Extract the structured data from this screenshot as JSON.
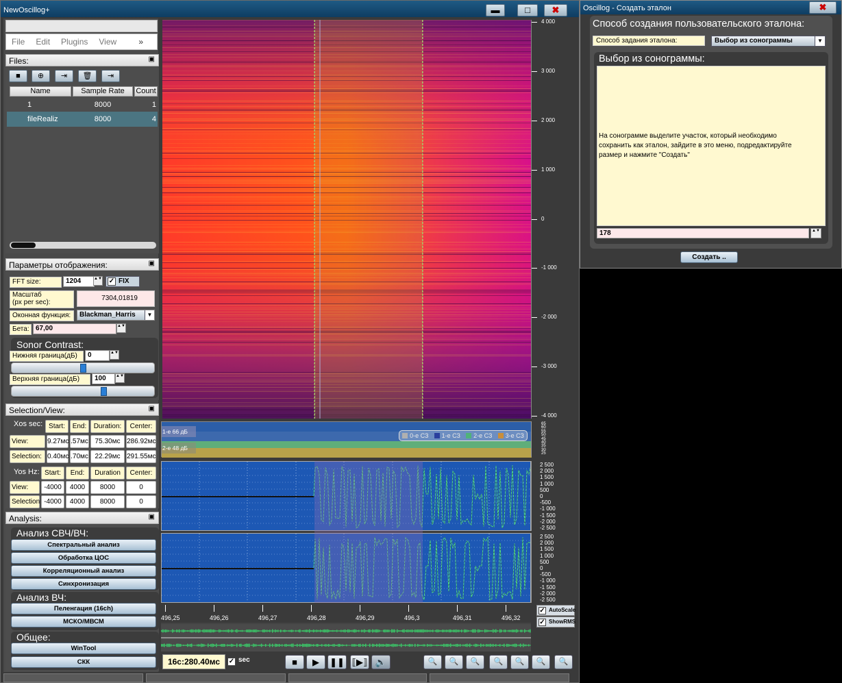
{
  "main_window": {
    "title": "NewOscillog+",
    "min_label": "▬",
    "max_label": "□",
    "close_label": "✖"
  },
  "menu": [
    "File",
    "Edit",
    "Plugins",
    "View"
  ],
  "menu_more": "»",
  "files": {
    "header": "Files:",
    "columns": [
      "Name",
      "Sample Rate",
      "Count"
    ],
    "rows": [
      {
        "name": "1",
        "rate": "8000",
        "count": "1"
      },
      {
        "name": "fileRealiz",
        "rate": "8000",
        "count": "4"
      }
    ]
  },
  "display": {
    "header": "Параметры отображения:",
    "fft_label": "FFT size:",
    "fft_value": "1204",
    "fix_label": "FIX",
    "scale_label_1": "Масштаб",
    "scale_label_2": "(px per sec):",
    "scale_value": "7304,01819",
    "window_label": "Оконная функция:",
    "window_value": "Blackman_Harris",
    "beta_label": "Бета:",
    "beta_value": "67,00",
    "contrast_title": "Sonor Contrast:",
    "lower_label": "Нижняя граница(дБ)",
    "lower_value": "0",
    "upper_label": "Верхняя граница(дБ)",
    "upper_value": "100",
    "lower_slider": 0.5,
    "upper_slider": 0.65
  },
  "selection": {
    "header": "Selection/View:",
    "xos_label": "Xos sec:",
    "x_cols": [
      "Start:",
      "End:",
      "Duration:",
      "Center:"
    ],
    "x_view_label": "View:",
    "x_view": [
      "9.27мс",
      ".57мс",
      "75.30мс",
      "286.92мс"
    ],
    "x_sel_label": "Selection:",
    "x_sel": [
      "0.40мс",
      ".70мс",
      "22.29мс",
      "291.55мс"
    ],
    "yos_label": "Yos Hz:",
    "y_cols": [
      "Start:",
      "End:",
      "Duration",
      "Center:"
    ],
    "y_view_label": "View:",
    "y_view": [
      "-4000",
      "4000",
      "8000",
      "0"
    ],
    "y_sel_label": "Selection",
    "y_sel": [
      "-4000",
      "4000",
      "8000",
      "0"
    ]
  },
  "analysis": {
    "header": "Analysis:",
    "group1": "Анализ СВЧ/ВЧ:",
    "g1_buttons": [
      "Спектральный анализ",
      "Обработка ЦОС",
      "Корреляционный анализ",
      "Синхронизация"
    ],
    "group2": "Анализ ВЧ:",
    "g2_buttons": [
      "Пеленгация (16ch)",
      "МСКО/МВСМ"
    ],
    "group3": "Общее:",
    "g3_buttons": [
      "WinTool",
      "СКК"
    ]
  },
  "spectrogram": {
    "y_ticks": [
      "4 000",
      "3 000",
      "2 000",
      "1 000",
      "0",
      "-1 000",
      "-2 000",
      "-3 000",
      "-4 000"
    ]
  },
  "meter": {
    "label1": "1-е 66 дБ",
    "label2": "2-е 48 дБ",
    "legend": [
      "0-е СЗ",
      "1-е СЗ",
      "2-е СЗ",
      "3-е СЗ"
    ],
    "legend_colors": [
      "#b0b0b0",
      "#2a3f9e",
      "#4fb27a",
      "#c98e3a"
    ],
    "axis_ticks": [
      "65",
      "60",
      "55",
      "50",
      "45",
      "40",
      "35",
      "30",
      "25"
    ]
  },
  "wave": {
    "y_ticks": [
      "2 500",
      "2 000",
      "1 500",
      "1 000",
      "500",
      "0",
      "-500",
      "-1 000",
      "-1 500",
      "-2 000",
      "-2 500"
    ]
  },
  "time_axis": [
    "496,25",
    "496,26",
    "496,27",
    "496,28",
    "496,29",
    "496,3",
    "496,31",
    "496,32"
  ],
  "autoscale_label": "AutoScale",
  "showrms_label": "ShowRMS",
  "time_display": "16с:280.40мс",
  "sec_label": "sec",
  "dialog": {
    "title": "Oscillog - Создать эталон",
    "close_label": "✖",
    "heading": "Способ создания пользовательского эталона:",
    "method_label": "Способ задания эталона:",
    "method_value": "Выбор из сонограммы",
    "section_title": "Выбор из сонограммы:",
    "instructions_1": "На сонограмме выделите участок, который необходимо",
    "instructions_2": "сохранить как эталон, зайдите в это меню, подредактируйте",
    "instructions_3": "размер и нажмите \"Создать\"",
    "number_value": "178",
    "create_button": "Создать .."
  }
}
